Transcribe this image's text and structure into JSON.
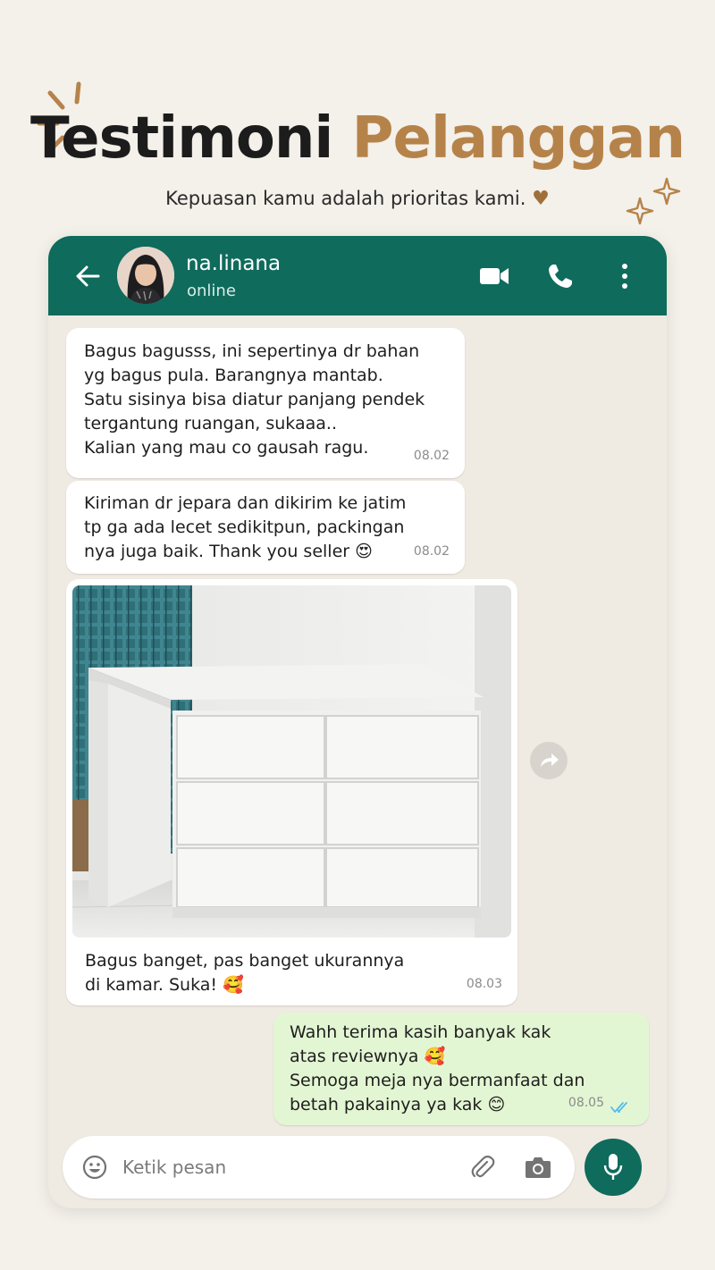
{
  "header": {
    "title_part1": "Testimoni",
    "title_part2": "Pelanggan",
    "subtitle": "Kepuasan kamu adalah prioritas kami.",
    "heart": "♥"
  },
  "chat": {
    "contact_name": "na.linana",
    "status": "online",
    "icons": [
      "back-arrow-icon",
      "video-call-icon",
      "phone-call-icon",
      "more-menu-icon"
    ]
  },
  "messages": [
    {
      "sender": "customer",
      "text": "Bagus bagusss, ini sepertinya dr bahan\nyg bagus pula. Barangnya mantab.\nSatu sisinya bisa diatur panjang pendek\ntergantung ruangan, sukaaa..\nKalian yang mau co gausah ragu.",
      "time": "08.02"
    },
    {
      "sender": "customer",
      "text": "Kiriman dr jepara dan dikirim ke jatim\ntp ga ada lecet sedikitpun, packingan\nnya juga baik. Thank you seller 😍",
      "time": "08.02"
    },
    {
      "sender": "customer",
      "has_photo": true,
      "text": "Bagus banget, pas banget ukurannya\ndi kamar. Suka! 🥰",
      "time": "08.03"
    },
    {
      "sender": "seller",
      "text": "Wahh terima kasih banyak kak\natas reviewnya 🥰\nSemoga meja nya bermanfaat dan\nbetah pakainya ya kak 😊",
      "time": "08.05",
      "read": true
    }
  ],
  "input": {
    "placeholder": "Ketik pesan"
  },
  "colors": {
    "header_bg": "#0f6b5c",
    "title_dark": "#1c1c1c",
    "title_accent": "#b5834a",
    "outgoing_bubble": "#e3f6d3",
    "chat_bg": "#efeae2",
    "read_ticks": "#53bdeb"
  }
}
